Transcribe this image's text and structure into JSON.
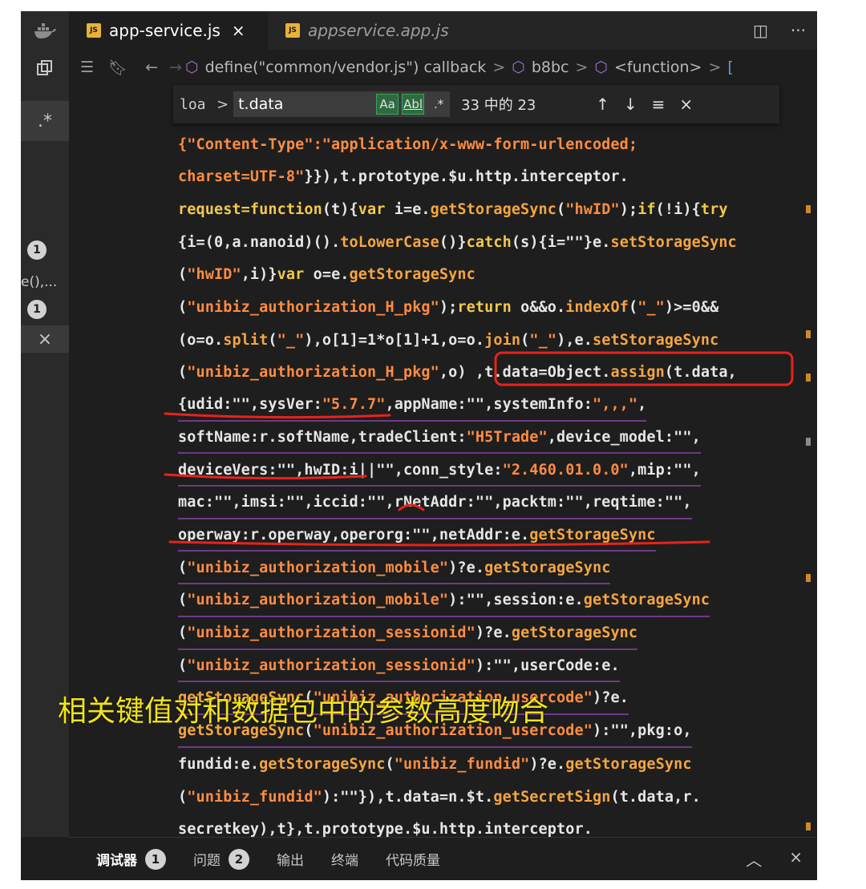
{
  "tabs": [
    {
      "label": "app-service.js",
      "badge": "JS",
      "close": "×"
    },
    {
      "label": "appservice.app.js",
      "badge": "JS"
    }
  ],
  "tab_actions": {
    "split": "◫",
    "more": "···"
  },
  "breadcrumb": {
    "items": [
      "define(\"common/vendor.js\") callback",
      "b8bc",
      "<function>"
    ],
    "trailing": "[",
    "separator": ">"
  },
  "find": {
    "prefix": "loa",
    "query": "t.data",
    "match_case": "Aa",
    "whole_word": "Abl",
    "regex": ".*",
    "count": "33 中的 23",
    "prev": "↑",
    "next": "↓",
    "selection": "≡",
    "close": "×"
  },
  "code_lines": [
    [
      [
        "s",
        "{\"Content-Type\":\"application/x-www-form-urlencoded;"
      ]
    ],
    [
      [
        "s",
        "charset=UTF-8\""
      ],
      [
        "p",
        "}}),t.prototype.$u.http.interceptor."
      ]
    ],
    [
      [
        "k",
        "request=function"
      ],
      [
        "p",
        "(t){"
      ],
      [
        "k",
        "var "
      ],
      [
        "p",
        "i=e."
      ],
      [
        "f",
        "getStorageSync"
      ],
      [
        "p",
        "("
      ],
      [
        "s",
        "\"hwID\""
      ],
      [
        "p",
        ");"
      ],
      [
        "k",
        "if"
      ],
      [
        "p",
        "(!i){"
      ],
      [
        "k",
        "try"
      ]
    ],
    [
      [
        "p",
        "{i=(0,a.nanoid)()."
      ],
      [
        "f",
        "toLowerCase"
      ],
      [
        "p",
        "()}"
      ],
      [
        "k",
        "catch"
      ],
      [
        "p",
        "(s){i=\"\"}e."
      ],
      [
        "f",
        "setStorageSync"
      ]
    ],
    [
      [
        "p",
        "("
      ],
      [
        "s",
        "\"hwID\""
      ],
      [
        "p",
        ",i)}"
      ],
      [
        "k",
        "var "
      ],
      [
        "p",
        "o=e."
      ],
      [
        "f",
        "getStorageSync"
      ]
    ],
    [
      [
        "p",
        "("
      ],
      [
        "s",
        "\"unibiz_authorization_H_pkg\""
      ],
      [
        "p",
        ");"
      ],
      [
        "k",
        "return "
      ],
      [
        "p",
        "o&&o."
      ],
      [
        "f",
        "indexOf"
      ],
      [
        "p",
        "("
      ],
      [
        "s",
        "\"_\""
      ],
      [
        "p",
        ")>=0&&"
      ]
    ],
    [
      [
        "p",
        "(o=o."
      ],
      [
        "f",
        "split"
      ],
      [
        "p",
        "("
      ],
      [
        "s",
        "\"_\""
      ],
      [
        "p",
        "),o[1]=1*o[1]+1,o=o."
      ],
      [
        "f",
        "join"
      ],
      [
        "p",
        "("
      ],
      [
        "s",
        "\"_\""
      ],
      [
        "p",
        "),e."
      ],
      [
        "f",
        "setStorageSync"
      ]
    ],
    [
      [
        "p",
        "("
      ],
      [
        "s",
        "\"unibiz_authorization_H_pkg\""
      ],
      [
        "p",
        ",o) ,t.data=Object."
      ],
      [
        "f",
        "assign"
      ],
      [
        "p",
        "(t.data,"
      ]
    ],
    [
      [
        "p",
        "{udid:\"\",sysVer:"
      ],
      [
        "s",
        "\"5.7.7\""
      ],
      [
        "p",
        ",appName:\"\",systemInfo:"
      ],
      [
        "s",
        "\",,,\""
      ],
      [
        "p",
        ","
      ]
    ],
    [
      [
        "p",
        "softName:r.softName,tradeClient:"
      ],
      [
        "s",
        "\"H5Trade\""
      ],
      [
        "p",
        ",device_model:\"\","
      ]
    ],
    [
      [
        "p",
        "deviceVers:\"\",hwID:i||\"\",conn_style:"
      ],
      [
        "s",
        "\"2.460.01.0.0\""
      ],
      [
        "p",
        ",mip:\"\","
      ]
    ],
    [
      [
        "p",
        "mac:\"\",imsi:\"\",iccid:\"\",rNetAddr:\"\",packtm:\"\",reqtime:\"\","
      ]
    ],
    [
      [
        "p",
        "operway:r.operway,operorg:\"\",netAddr:e."
      ],
      [
        "f",
        "getStorageSync"
      ]
    ],
    [
      [
        "p",
        "("
      ],
      [
        "s",
        "\"unibiz_authorization_mobile\""
      ],
      [
        "p",
        ")?e."
      ],
      [
        "f",
        "getStorageSync"
      ]
    ],
    [
      [
        "p",
        "("
      ],
      [
        "s",
        "\"unibiz_authorization_mobile\""
      ],
      [
        "p",
        "):\"\",session:e."
      ],
      [
        "f",
        "getStorageSync"
      ]
    ],
    [
      [
        "p",
        "("
      ],
      [
        "s",
        "\"unibiz_authorization_sessionid\""
      ],
      [
        "p",
        ")?e."
      ],
      [
        "f",
        "getStorageSync"
      ]
    ],
    [
      [
        "p",
        "("
      ],
      [
        "s",
        "\"unibiz_authorization_sessionid\""
      ],
      [
        "p",
        "):\"\",userCode:e."
      ]
    ],
    [
      [
        "f",
        "getStorageSync"
      ],
      [
        "p",
        "("
      ],
      [
        "s",
        "\"unibiz_authorization_usercode\""
      ],
      [
        "p",
        ")?e."
      ]
    ],
    [
      [
        "f",
        "getStorageSync"
      ],
      [
        "p",
        "("
      ],
      [
        "s",
        "\"unibiz_authorization_usercode\""
      ],
      [
        "p",
        "):\"\",pkg:o,"
      ]
    ],
    [
      [
        "p",
        "fundid:e."
      ],
      [
        "f",
        "getStorageSync"
      ],
      [
        "p",
        "("
      ],
      [
        "s",
        "\"unibiz_fundid\""
      ],
      [
        "p",
        ")?e."
      ],
      [
        "f",
        "getStorageSync"
      ]
    ],
    [
      [
        "p",
        "("
      ],
      [
        "s",
        "\"unibiz_fundid\""
      ],
      [
        "p",
        "):\"\"}),t.data=n.$t."
      ],
      [
        "f",
        "getSecretSign"
      ],
      [
        "p",
        "(t.data,r."
      ]
    ],
    [
      [
        "p",
        "secretkey),t},t.prototype.$u.http.interceptor."
      ]
    ]
  ],
  "annotation_text": "相关键值对和数据包中的参数高度吻合",
  "sidebar": {
    "badge_count_1": "1",
    "fragment": "e(),...",
    "badge_count_2": "1",
    "close": "×",
    "star": ".*"
  },
  "panel": {
    "tabs": [
      {
        "label": "调试器",
        "badge": "1"
      },
      {
        "label": "问题",
        "badge": "2"
      },
      {
        "label": "输出"
      },
      {
        "label": "终端"
      },
      {
        "label": "代码质量"
      }
    ],
    "collapse": "︿",
    "close": "×"
  },
  "colors": {
    "annotation_red": "#e8231c",
    "annotation_yellow": "#f2e318"
  }
}
